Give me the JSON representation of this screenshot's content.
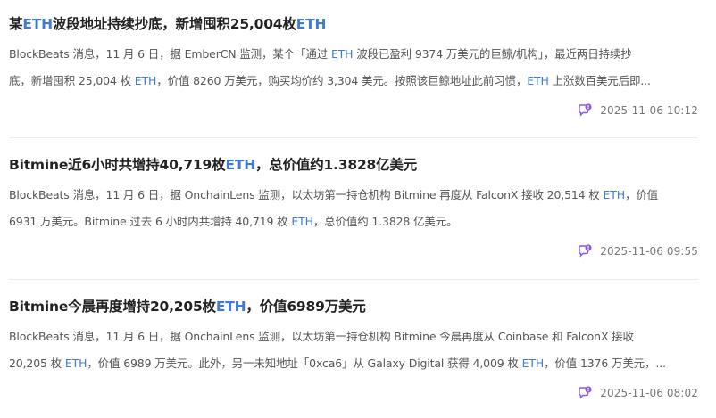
{
  "colors": {
    "accent": "#3e7ad6",
    "title": "#222222",
    "text": "#555555",
    "meta": "#777777",
    "icon": "#8a5bd6"
  },
  "icons": {
    "comment": "comment-bubble-icon"
  },
  "items": [
    {
      "title": [
        {
          "t": "某",
          "hl": false
        },
        {
          "t": "ETH",
          "hl": true
        },
        {
          "t": "波段地址持续抄底，新增囤积25,004枚",
          "hl": false
        },
        {
          "t": "ETH",
          "hl": true
        }
      ],
      "summary_lines": [
        [
          {
            "t": "BlockBeats 消息，11 月 6 日，据 EmberCN 监测，某个「通过 ",
            "hl": false
          },
          {
            "t": "ETH",
            "hl": true
          },
          {
            "t": " 波段已盈利 9374 万美元的巨鲸/机构」，最近两日持续抄",
            "hl": false
          }
        ],
        [
          {
            "t": "底，新增囤积 25,004 枚 ",
            "hl": false
          },
          {
            "t": "ETH",
            "hl": true
          },
          {
            "t": "，价值 8260 万美元，购买均价约 3,304 美元。按照该巨鲸地址此前习惯，",
            "hl": false
          },
          {
            "t": "ETH",
            "hl": true
          },
          {
            "t": " 上涨数百美元后即...",
            "hl": false
          }
        ]
      ],
      "time": "2025-11-06 10:12"
    },
    {
      "title": [
        {
          "t": "Bitmine近6小时共增持40,719枚",
          "hl": false
        },
        {
          "t": "ETH",
          "hl": true
        },
        {
          "t": "，总价值约1.3828亿美元",
          "hl": false
        }
      ],
      "summary_lines": [
        [
          {
            "t": "BlockBeats 消息，11 月 6 日，据 OnchainLens 监测，以太坊第一持仓机构 Bitmine 再度从 FalconX 接收 20,514 枚 ",
            "hl": false
          },
          {
            "t": "ETH",
            "hl": true
          },
          {
            "t": "，价值",
            "hl": false
          }
        ],
        [
          {
            "t": "6931 万美元。Bitmine 过去 6 小时内共增持 40,719 枚 ",
            "hl": false
          },
          {
            "t": "ETH",
            "hl": true
          },
          {
            "t": "，总价值约 1.3828 亿美元。",
            "hl": false
          }
        ]
      ],
      "time": "2025-11-06 09:55"
    },
    {
      "title": [
        {
          "t": "Bitmine今晨再度增持20,205枚",
          "hl": false
        },
        {
          "t": "ETH",
          "hl": true
        },
        {
          "t": "，价值6989万美元",
          "hl": false
        }
      ],
      "summary_lines": [
        [
          {
            "t": "BlockBeats 消息，11 月 6 日，据 OnchainLens 监测，以太坊第一持仓机构 Bitmine 今晨再度从 Coinbase 和 FalconX 接收",
            "hl": false
          }
        ],
        [
          {
            "t": "20,205 枚 ",
            "hl": false
          },
          {
            "t": "ETH",
            "hl": true
          },
          {
            "t": "，价值 6989 万美元。此外，另一未知地址「0xca6」从 Galaxy Digital 获得 4,009 枚 ",
            "hl": false
          },
          {
            "t": "ETH",
            "hl": true
          },
          {
            "t": "，价值 1376 万美元，...",
            "hl": false
          }
        ]
      ],
      "time": "2025-11-06 08:02"
    }
  ]
}
